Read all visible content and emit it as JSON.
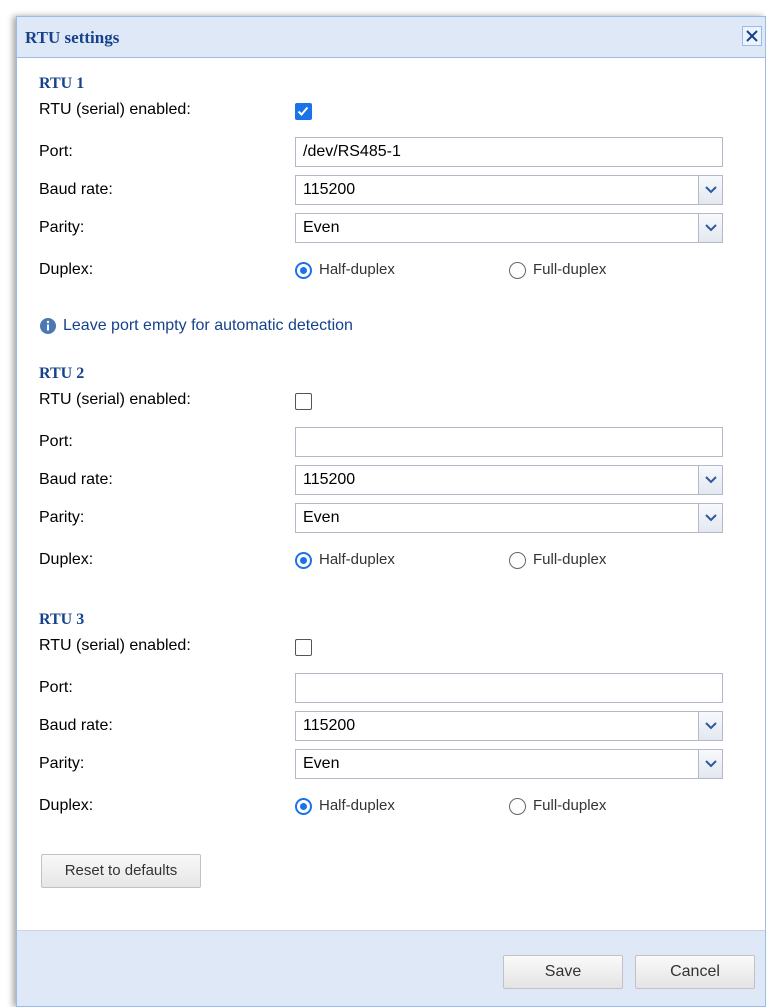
{
  "dialog": {
    "title": "RTU settings",
    "close_icon": "close-icon"
  },
  "labels": {
    "enabled": "RTU (serial) enabled:",
    "port": "Port:",
    "baud_rate": "Baud rate:",
    "parity": "Parity:",
    "duplex": "Duplex:",
    "half_duplex": "Half-duplex",
    "full_duplex": "Full-duplex"
  },
  "rtus": [
    {
      "title": "RTU 1",
      "enabled": true,
      "port": "/dev/RS485-1",
      "baud_rate": "115200",
      "parity": "Even",
      "duplex": "Half-duplex"
    },
    {
      "title": "RTU 2",
      "enabled": false,
      "port": "",
      "baud_rate": "115200",
      "parity": "Even",
      "duplex": "Half-duplex"
    },
    {
      "title": "RTU 3",
      "enabled": false,
      "port": "",
      "baud_rate": "115200",
      "parity": "Even",
      "duplex": "Half-duplex"
    }
  ],
  "info_text": "Leave port empty for automatic detection",
  "buttons": {
    "reset": "Reset to defaults",
    "save": "Save",
    "cancel": "Cancel"
  },
  "colors": {
    "accent": "#1a73e8",
    "title_blue": "#15428b",
    "header_bg": "#dfe8f6"
  }
}
